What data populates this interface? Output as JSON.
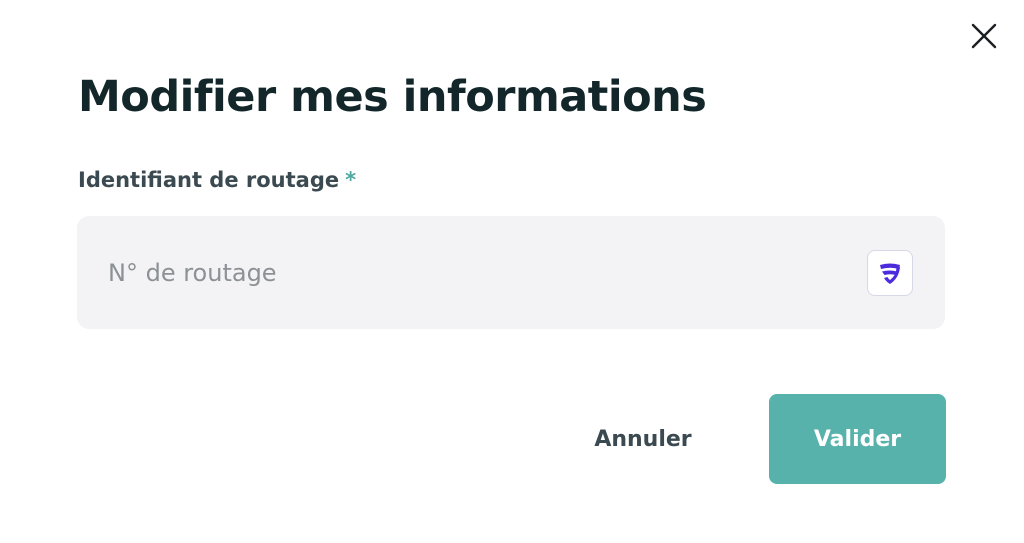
{
  "dialog": {
    "title": "Modifier mes informations",
    "close_icon": "close-icon"
  },
  "field": {
    "label": "Identifiant de routage",
    "required_marker": "*",
    "value": "",
    "placeholder": "N° de routage",
    "badge_icon": "shield-logo-icon"
  },
  "actions": {
    "cancel_label": "Annuler",
    "submit_label": "Valider"
  },
  "colors": {
    "title": "#13272b",
    "label": "#3b4a50",
    "required": "#4fa89e",
    "input_background": "#f3f3f5",
    "placeholder": "#8c9195",
    "submit_background": "#57b2ab",
    "submit_text": "#ffffff",
    "badge_icon": "#4b2bdc"
  }
}
